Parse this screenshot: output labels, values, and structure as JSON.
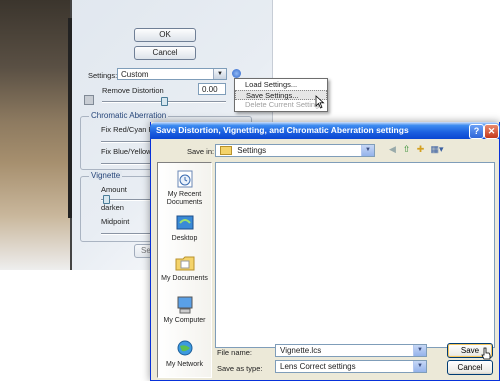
{
  "background_dialog": {
    "ok_label": "OK",
    "cancel_label": "Cancel",
    "settings_label": "Settings:",
    "settings_value": "Custom",
    "remove_distortion_label": "Remove Distortion",
    "remove_distortion_value": "0.00",
    "chromatic_aberration_title": "Chromatic Aberration",
    "fix_red_cyan_label": "Fix Red/Cyan Fr",
    "fix_blue_yellow_label": "Fix Blue/Yellow F",
    "vignette_title": "Vignette",
    "amount_label": "Amount",
    "darken_label": "darken",
    "midpoint_label": "Midpoint",
    "set_button_partial": "Set"
  },
  "context_menu": {
    "items": [
      {
        "label": "Load Settings...",
        "enabled": true
      },
      {
        "label": "Save Settings...",
        "enabled": true,
        "highlighted": true
      },
      {
        "label": "Delete Current Setting",
        "enabled": false
      }
    ]
  },
  "save_dialog": {
    "title": "Save Distortion, Vignetting, and Chromatic Aberration settings",
    "help_glyph": "?",
    "close_glyph": "✕",
    "save_in_label": "Save in:",
    "save_in_value": "Settings",
    "places": [
      {
        "label": "My Recent Documents",
        "icon": "recent-documents-icon"
      },
      {
        "label": "Desktop",
        "icon": "desktop-icon"
      },
      {
        "label": "My Documents",
        "icon": "my-documents-icon"
      },
      {
        "label": "My Computer",
        "icon": "my-computer-icon"
      },
      {
        "label": "My Network",
        "icon": "my-network-icon"
      }
    ],
    "file_name_label": "File name:",
    "file_name_value": "Vignette.lcs",
    "save_as_type_label": "Save as type:",
    "save_as_type_value": "Lens Correct settings",
    "save_label": "Save",
    "cancel_label": "Cancel"
  }
}
